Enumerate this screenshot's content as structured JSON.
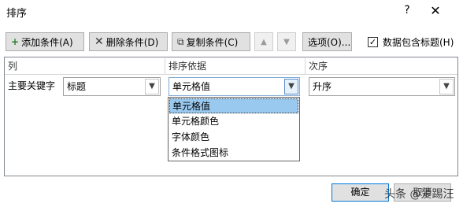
{
  "window": {
    "title": "排序",
    "help": "?",
    "close": "✕"
  },
  "toolbar": {
    "add_label": "添加条件(A)",
    "delete_label": "删除条件(D)",
    "copy_label": "复制条件(C)",
    "options_label": "选项(O)...",
    "header_checkbox_label": "数据包含标题(H)",
    "header_checkbox_checked": true
  },
  "grid": {
    "columns": [
      "列",
      "排序依据",
      "次序"
    ],
    "row": {
      "label": "主要关键字",
      "key_value": "标题",
      "basis_value": "单元格值",
      "order_value": "升序"
    }
  },
  "dropdown": {
    "options": [
      "单元格值",
      "单元格颜色",
      "字体颜色",
      "条件格式图标"
    ],
    "selected_index": 0
  },
  "footer": {
    "ok_label": "确定",
    "cancel_label": "取消"
  },
  "watermark": {
    "text": "头条 @爱踢汪"
  }
}
